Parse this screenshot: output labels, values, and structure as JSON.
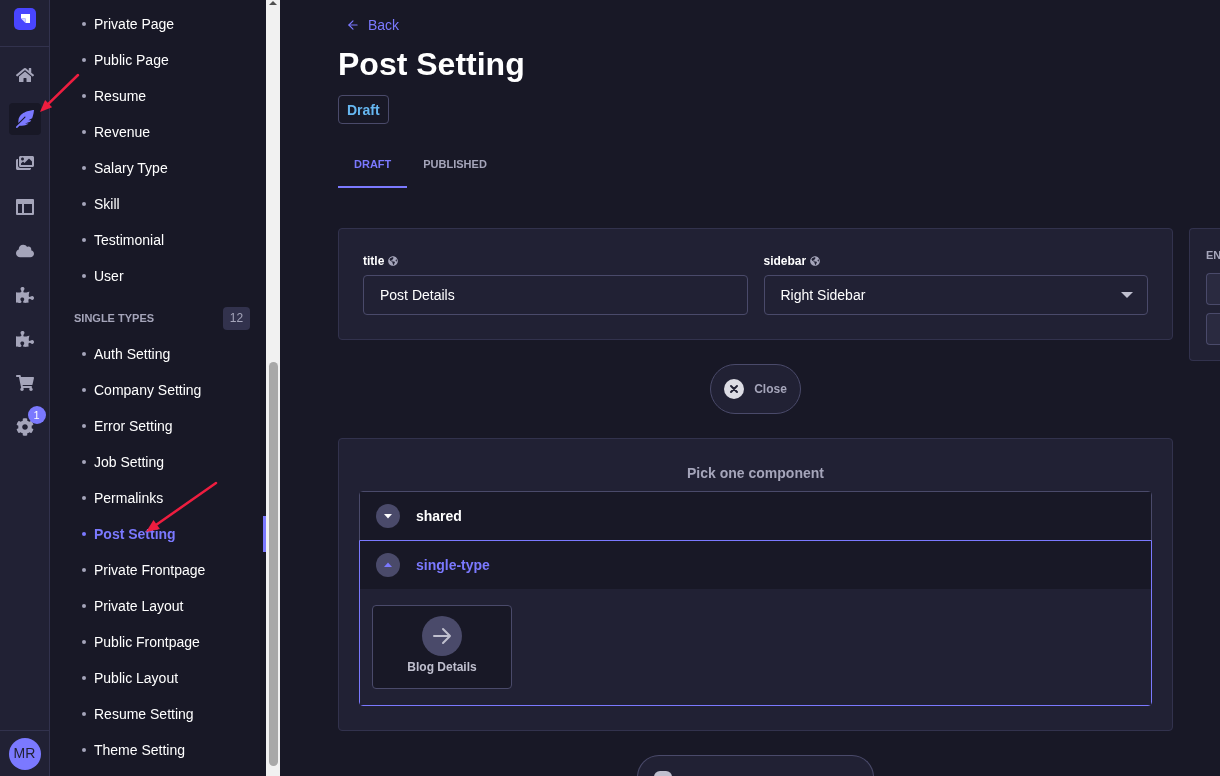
{
  "nav_rail": {
    "items": [
      {
        "kind": "home",
        "selected": false
      },
      {
        "kind": "content",
        "selected": true
      },
      {
        "kind": "media",
        "selected": false
      },
      {
        "kind": "layout",
        "selected": false
      },
      {
        "kind": "cloud",
        "selected": false
      },
      {
        "kind": "plugin",
        "selected": false
      },
      {
        "kind": "plugin",
        "selected": false
      },
      {
        "kind": "cart",
        "selected": false
      },
      {
        "kind": "settings",
        "selected": false,
        "badge": "1"
      }
    ],
    "avatar": "MR"
  },
  "sidebar": {
    "collection_items": [
      {
        "label": "Private Page",
        "selected": false
      },
      {
        "label": "Public Page",
        "selected": false
      },
      {
        "label": "Resume",
        "selected": false
      },
      {
        "label": "Revenue",
        "selected": false
      },
      {
        "label": "Salary Type",
        "selected": false
      },
      {
        "label": "Skill",
        "selected": false
      },
      {
        "label": "Testimonial",
        "selected": false
      },
      {
        "label": "User",
        "selected": false
      }
    ],
    "single_types": {
      "heading": "SINGLE TYPES",
      "count": "12",
      "items": [
        {
          "label": "Auth Setting",
          "selected": false
        },
        {
          "label": "Company Setting",
          "selected": false
        },
        {
          "label": "Error Setting",
          "selected": false
        },
        {
          "label": "Job Setting",
          "selected": false
        },
        {
          "label": "Permalinks",
          "selected": false
        },
        {
          "label": "Post Setting",
          "selected": true
        },
        {
          "label": "Private Frontpage",
          "selected": false
        },
        {
          "label": "Private Layout",
          "selected": false
        },
        {
          "label": "Public Frontpage",
          "selected": false
        },
        {
          "label": "Public Layout",
          "selected": false
        },
        {
          "label": "Resume Setting",
          "selected": false
        },
        {
          "label": "Theme Setting",
          "selected": false
        }
      ]
    }
  },
  "header": {
    "back": "Back",
    "title": "Post Setting",
    "status": "Draft"
  },
  "tabs": [
    {
      "label": "DRAFT",
      "selected": true
    },
    {
      "label": "PUBLISHED",
      "selected": false
    }
  ],
  "form": {
    "fields": [
      {
        "kind": "text",
        "label": "title",
        "value": "Post Details"
      },
      {
        "kind": "select",
        "label": "sidebar",
        "value": "Right Sidebar"
      }
    ]
  },
  "side_panel": {
    "heading": "EN"
  },
  "close_button": "Close",
  "picker": {
    "title": "Pick one component",
    "categories": [
      {
        "name": "shared",
        "expanded": false
      },
      {
        "name": "single-type",
        "expanded": true,
        "components": [
          {
            "label": "Blog Details"
          }
        ]
      }
    ]
  }
}
